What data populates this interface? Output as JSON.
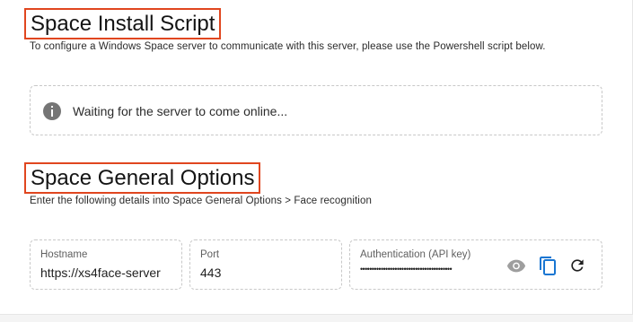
{
  "install": {
    "title": "Space Install Script",
    "description": "To configure a Windows Space server to communicate with this server, please use the Powershell script below.",
    "status_text": "Waiting for the server to come online..."
  },
  "general": {
    "title": "Space General Options",
    "description": "Enter the following details into Space General Options > Face recognition",
    "hostname": {
      "label": "Hostname",
      "value": "https://xs4face-server"
    },
    "port": {
      "label": "Port",
      "value": "443"
    },
    "auth": {
      "label": "Authentication (API key)",
      "masked_value": "••••••••••••••••••••••••••••••••••••••••"
    }
  },
  "icons": {
    "info": "info-icon",
    "visibility": "eye-icon",
    "copy": "copy-icon",
    "refresh": "refresh-icon"
  },
  "colors": {
    "highlight_border": "#e0461f",
    "copy_icon": "#1976d2",
    "eye_icon": "#9e9e9e"
  }
}
